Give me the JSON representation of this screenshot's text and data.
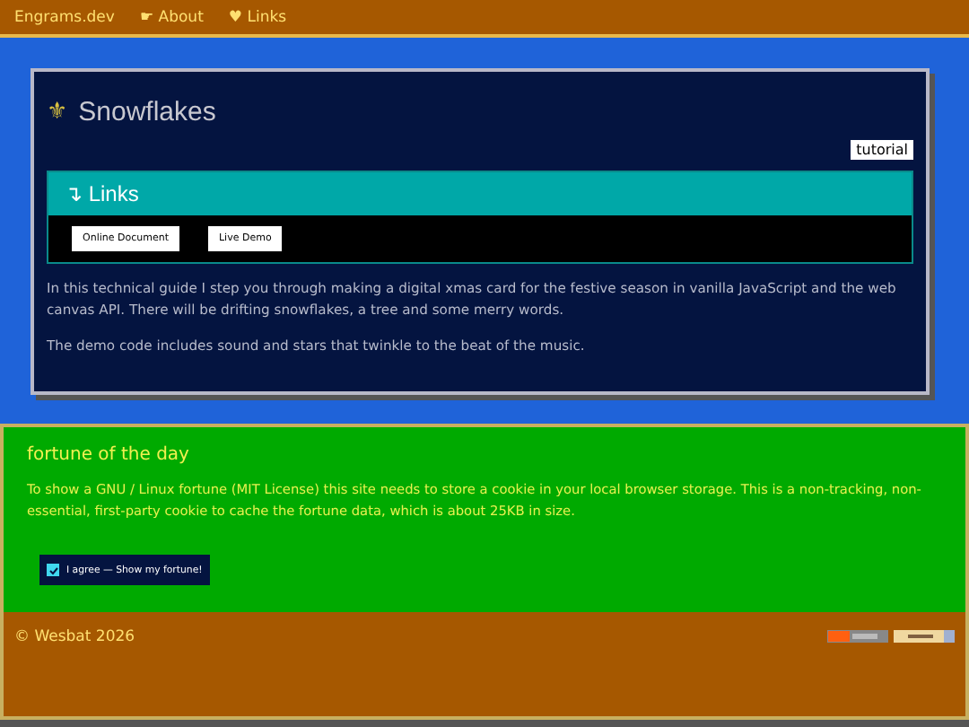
{
  "nav": {
    "brand": "Engrams.dev",
    "items": [
      {
        "icon": "☛",
        "label": "About"
      },
      {
        "icon": "♥",
        "label": "Links"
      }
    ]
  },
  "article": {
    "icon": "⚜",
    "title": "Snowflakes",
    "tag": "tutorial",
    "links": {
      "icon": "↴",
      "title": "Links",
      "buttons": [
        "Online Document",
        "Live Demo"
      ]
    },
    "paragraphs": [
      "In this technical guide I step you through making a digital xmas card for the festive season in vanilla JavaScript and the web canvas API. There will be drifting snowflakes, a tree and some merry words.",
      "The demo code includes sound and stars that twinkle to the beat of the music."
    ]
  },
  "fortune": {
    "title": "fortune of the day",
    "text": "To show a GNU / Linux fortune (MIT License) this site needs to store a cookie in your local browser storage. This is a non-tracking, non-essential, first-party cookie to cache the fortune data, which is about 25KB in size.",
    "consent": {
      "label": "I agree — Show my fortune!",
      "checked": true
    }
  },
  "footer": {
    "copyright": "© Wesbat 2026"
  }
}
